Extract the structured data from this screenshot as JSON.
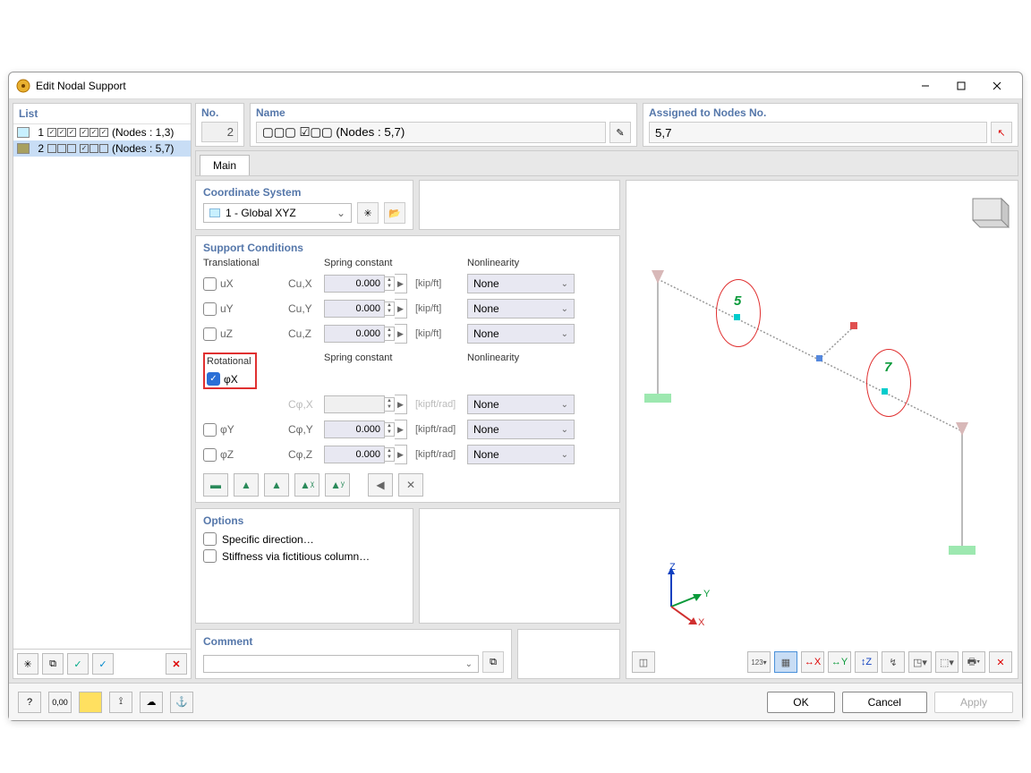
{
  "title": "Edit Nodal Support",
  "list": {
    "header": "List",
    "items": [
      {
        "no": "1",
        "color": "#c8f0ff",
        "chk1": [
          true,
          true,
          true
        ],
        "chk2": [
          true,
          true,
          true
        ],
        "text": "(Nodes : 1,3)",
        "selected": false
      },
      {
        "no": "2",
        "color": "#a8a060",
        "chk1": [
          false,
          false,
          false
        ],
        "chk2": [
          true,
          false,
          false
        ],
        "text": "(Nodes : 5,7)",
        "selected": true
      }
    ]
  },
  "no_field": {
    "label": "No.",
    "value": "2"
  },
  "name_field": {
    "label": "Name",
    "value": "▢▢▢ ☑▢▢ (Nodes : 5,7)"
  },
  "assigned": {
    "label": "Assigned to Nodes No.",
    "value": "5,7"
  },
  "tab_main": "Main",
  "coord_sys": {
    "label": "Coordinate System",
    "value": "1 - Global XYZ"
  },
  "support": {
    "label": "Support Conditions",
    "trans_hdr": "Translational",
    "spring_hdr": "Spring constant",
    "nl_hdr": "Nonlinearity",
    "rot_hdr": "Rotational",
    "trans": [
      {
        "sym": "uX",
        "checked": false,
        "c": "Cu,X",
        "val": "0.000",
        "unit": "[kip/ft]",
        "nl": "None"
      },
      {
        "sym": "uY",
        "checked": false,
        "c": "Cu,Y",
        "val": "0.000",
        "unit": "[kip/ft]",
        "nl": "None"
      },
      {
        "sym": "uZ",
        "checked": false,
        "c": "Cu,Z",
        "val": "0.000",
        "unit": "[kip/ft]",
        "nl": "None"
      }
    ],
    "rot": [
      {
        "sym": "φX",
        "checked": true,
        "c": "Cφ,X",
        "val": "",
        "unit": "[kipft/rad]",
        "nl": "None"
      },
      {
        "sym": "φY",
        "checked": false,
        "c": "Cφ,Y",
        "val": "0.000",
        "unit": "[kipft/rad]",
        "nl": "None"
      },
      {
        "sym": "φZ",
        "checked": false,
        "c": "Cφ,Z",
        "val": "0.000",
        "unit": "[kipft/rad]",
        "nl": "None"
      }
    ]
  },
  "options": {
    "label": "Options",
    "specific": "Specific direction…",
    "stiffness": "Stiffness via fictitious column…"
  },
  "comment": {
    "label": "Comment"
  },
  "preview": {
    "node5": "5",
    "node7": "7",
    "axisX": "X",
    "axisY": "Y",
    "axisZ": "Z"
  },
  "buttons": {
    "ok": "OK",
    "cancel": "Cancel",
    "apply": "Apply"
  }
}
